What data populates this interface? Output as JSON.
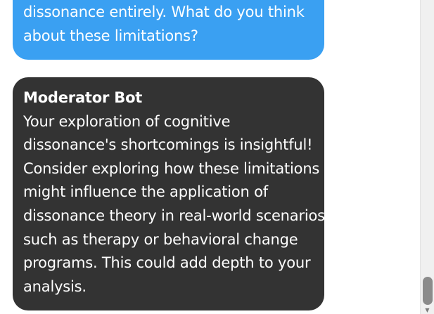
{
  "messages": [
    {
      "role": "user",
      "lines": [
        "dissonance entirely. What do you think",
        "about these limitations?"
      ]
    },
    {
      "role": "bot",
      "sender": "Moderator Bot",
      "lines": [
        "Your exploration of cognitive",
        "dissonance's shortcomings is insightful!",
        "Consider exploring how these limitations",
        "might influence the application of",
        "dissonance theory in real-world scenarios,",
        "such as therapy or behavioral change",
        "programs. This could add depth to your",
        "analysis."
      ]
    }
  ],
  "colors": {
    "user_bubble": "#3aa0f2",
    "bot_bubble": "#333333",
    "text": "#ffffff"
  },
  "icons": {
    "scroll_down": "chevron-down-icon"
  }
}
